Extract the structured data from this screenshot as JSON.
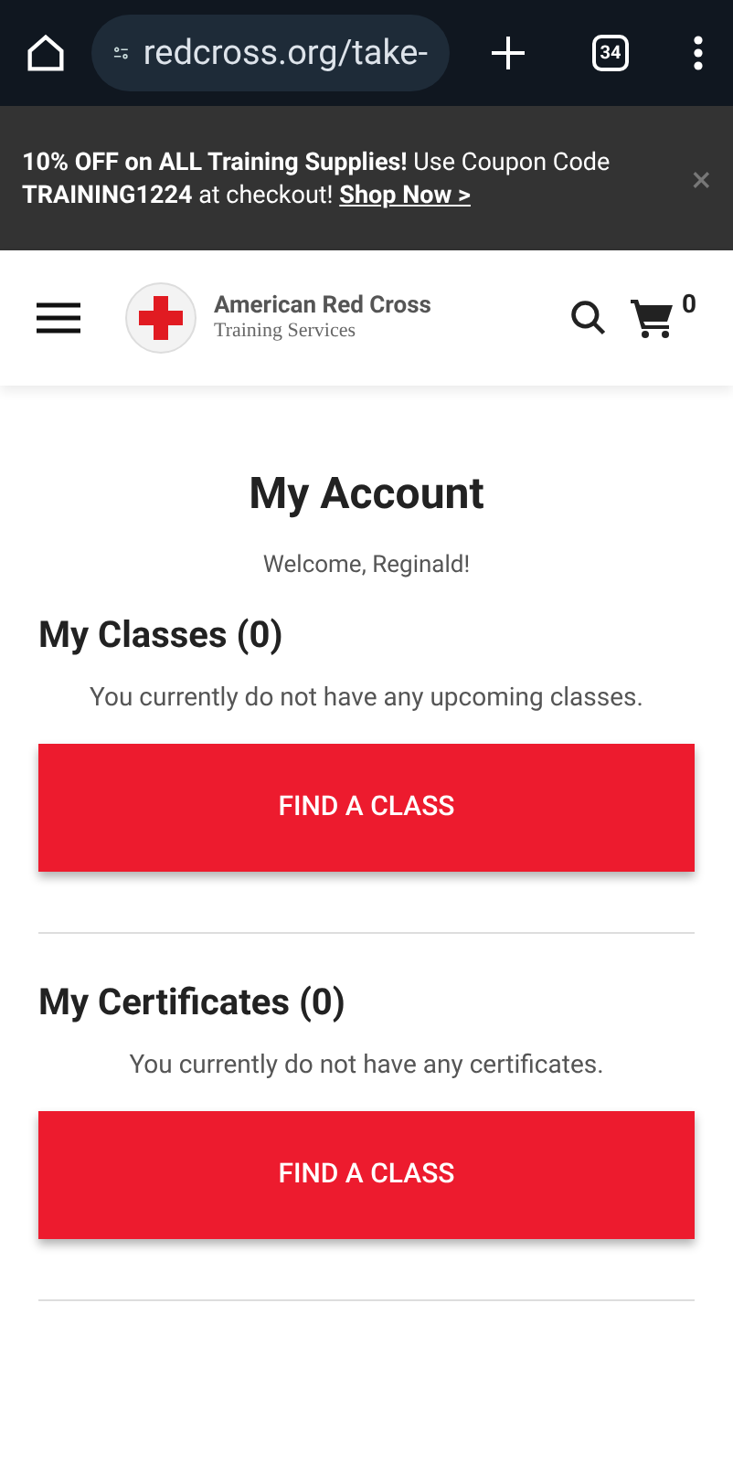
{
  "browser": {
    "url": "redcross.org/take-",
    "tab_count": "34"
  },
  "promo": {
    "text": "**10% OFF on ALL Training Supplies!** Use Coupon Code **TRAINING1224** at checkout!",
    "link": "Shop Now >",
    "close": "×"
  },
  "header": {
    "brand": "American Red Cross",
    "tagline": "Training Services",
    "cart_count": "0"
  },
  "page": {
    "title": "My Account",
    "welcome": "Welcome, Reginald!"
  },
  "sections": [
    {
      "heading": "My Classes (0)",
      "message": "You currently do not have any upcoming classes.",
      "button": "FIND A CLASS"
    },
    {
      "heading": "My Certificates (0)",
      "message": "You currently do not have any certificates.",
      "button": "FIND A CLASS"
    }
  ]
}
